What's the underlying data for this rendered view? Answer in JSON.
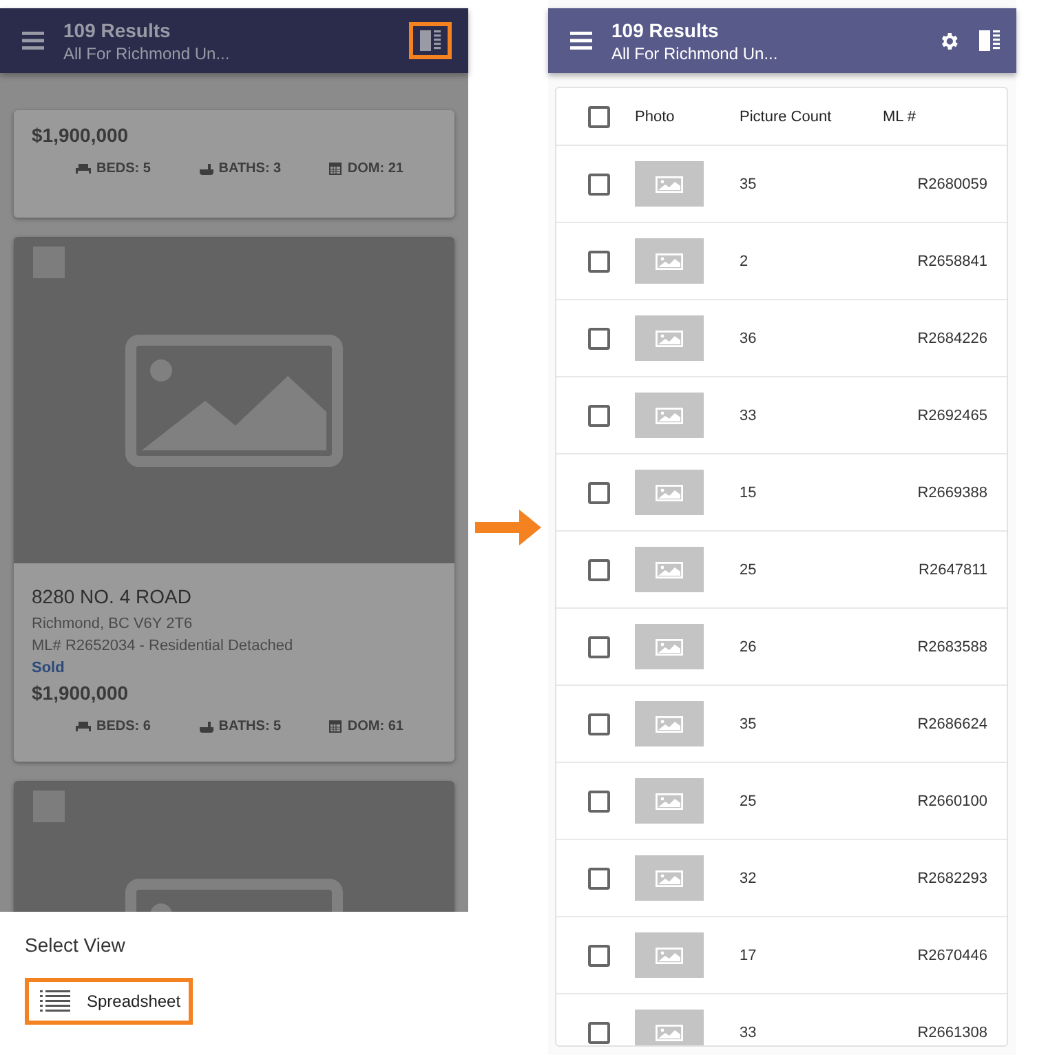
{
  "list_view": {
    "header": {
      "title": "109 Results",
      "subtitle": "All For Richmond Un..."
    },
    "listings": [
      {
        "kind": "partial",
        "price": "$1,900,000",
        "beds": "BEDS: 5",
        "baths": "BATHS: 3",
        "dom": "DOM: 21"
      },
      {
        "kind": "full",
        "checked": false,
        "address": "8280 NO. 4 ROAD",
        "city": "Richmond, BC V6Y 2T6",
        "ml": "ML# R2652034 - Residential Detached",
        "status": "Sold",
        "price": "$1,900,000",
        "beds": "BEDS: 6",
        "baths": "BATHS: 5",
        "dom": "DOM: 61"
      },
      {
        "kind": "photo_only",
        "checked": false
      }
    ],
    "sheet": {
      "title": "Select View",
      "options": [
        {
          "label": "Spreadsheet",
          "highlighted": true
        }
      ]
    }
  },
  "spreadsheet_view": {
    "header": {
      "title": "109 Results",
      "subtitle": "All For Richmond Un..."
    },
    "table": {
      "all_checked": false,
      "columns": [
        "Photo",
        "Picture Count",
        "ML #"
      ],
      "rows": [
        {
          "checked": false,
          "count": "35",
          "ml": "R2680059"
        },
        {
          "checked": false,
          "count": "2",
          "ml": "R2658841"
        },
        {
          "checked": false,
          "count": "36",
          "ml": "R2684226"
        },
        {
          "checked": false,
          "count": "33",
          "ml": "R2692465"
        },
        {
          "checked": false,
          "count": "15",
          "ml": "R2669388"
        },
        {
          "checked": false,
          "count": "25",
          "ml": "R2647811"
        },
        {
          "checked": false,
          "count": "26",
          "ml": "R2683588"
        },
        {
          "checked": false,
          "count": "35",
          "ml": "R2686624"
        },
        {
          "checked": false,
          "count": "25",
          "ml": "R2660100"
        },
        {
          "checked": false,
          "count": "32",
          "ml": "R2682293"
        },
        {
          "checked": false,
          "count": "17",
          "ml": "R2670446"
        },
        {
          "checked": false,
          "count": "33",
          "ml": "R2661308"
        }
      ]
    }
  }
}
